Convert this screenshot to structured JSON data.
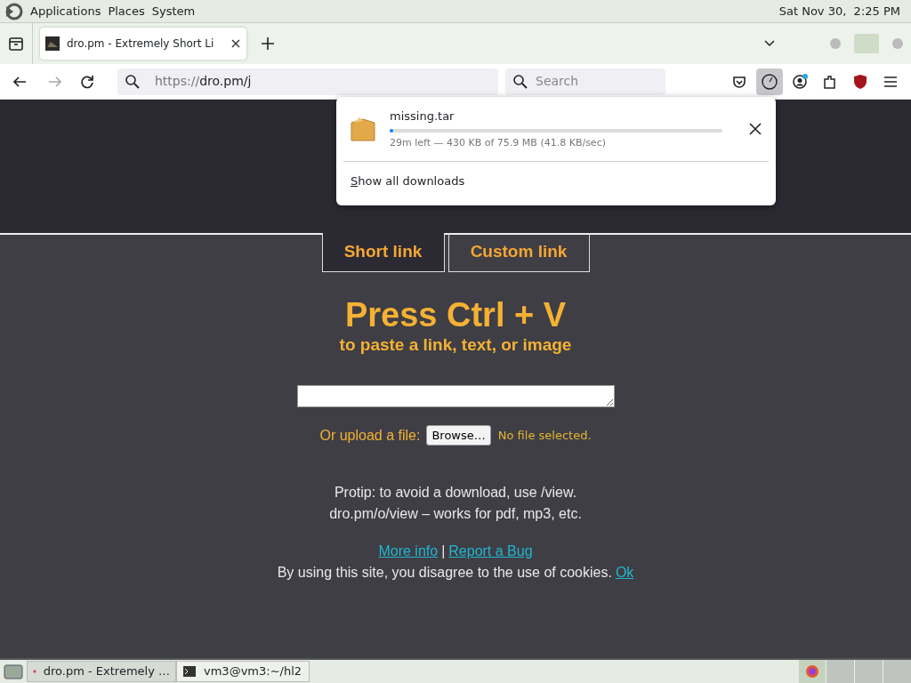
{
  "desktop_panel": {
    "menus": [
      "Applications",
      "Places",
      "System"
    ],
    "clock": "Sat Nov 30,  2:25 PM"
  },
  "browser": {
    "tabs": [
      {
        "title": "dro.pm - Extremely Short Li",
        "selected": true
      }
    ],
    "url_scheme": "https://",
    "url_rest": "dro.pm/j",
    "search_placeholder": "Search",
    "toolbar_buttons": [
      {
        "kind": "pocket",
        "pressed": false
      },
      {
        "kind": "downloads",
        "pressed": true
      },
      {
        "kind": "account",
        "pressed": false
      },
      {
        "kind": "extensions",
        "pressed": false
      },
      {
        "kind": "shield",
        "pressed": false
      },
      {
        "kind": "menu",
        "pressed": false
      }
    ]
  },
  "downloads_panel": {
    "items": [
      {
        "name": "missing.tar",
        "level": 0.01,
        "status": "29m left — 430 KB of 75.9 MB (41.8 KB/sec)"
      }
    ],
    "show_all": "Show all downloads"
  },
  "page": {
    "tabs": [
      {
        "label": "Short link",
        "selected": true
      },
      {
        "label": "Custom link",
        "selected": false
      }
    ],
    "heading": "Press Ctrl + V",
    "subheading": "to paste a link, text, or image",
    "upload_label": "Or upload a file:",
    "browse_button": "Browse…",
    "file_status": "No file selected.",
    "protip_lines": [
      "Protip: to avoid a download, use /view.",
      "dro.pm/o/view – works for pdf, mp3, etc."
    ],
    "links": [
      "More info",
      "Report a Bug"
    ],
    "separator": "|",
    "cookie_text": "By using this site, you disagree to the use of cookies.",
    "cookie_ok": "Ok"
  },
  "taskbar": {
    "tasks": [
      {
        "label": "dro.pm - Extremely …",
        "kind": "firefox"
      },
      {
        "label": "vm3@vm3:~/hl2",
        "kind": "terminal"
      }
    ]
  }
}
